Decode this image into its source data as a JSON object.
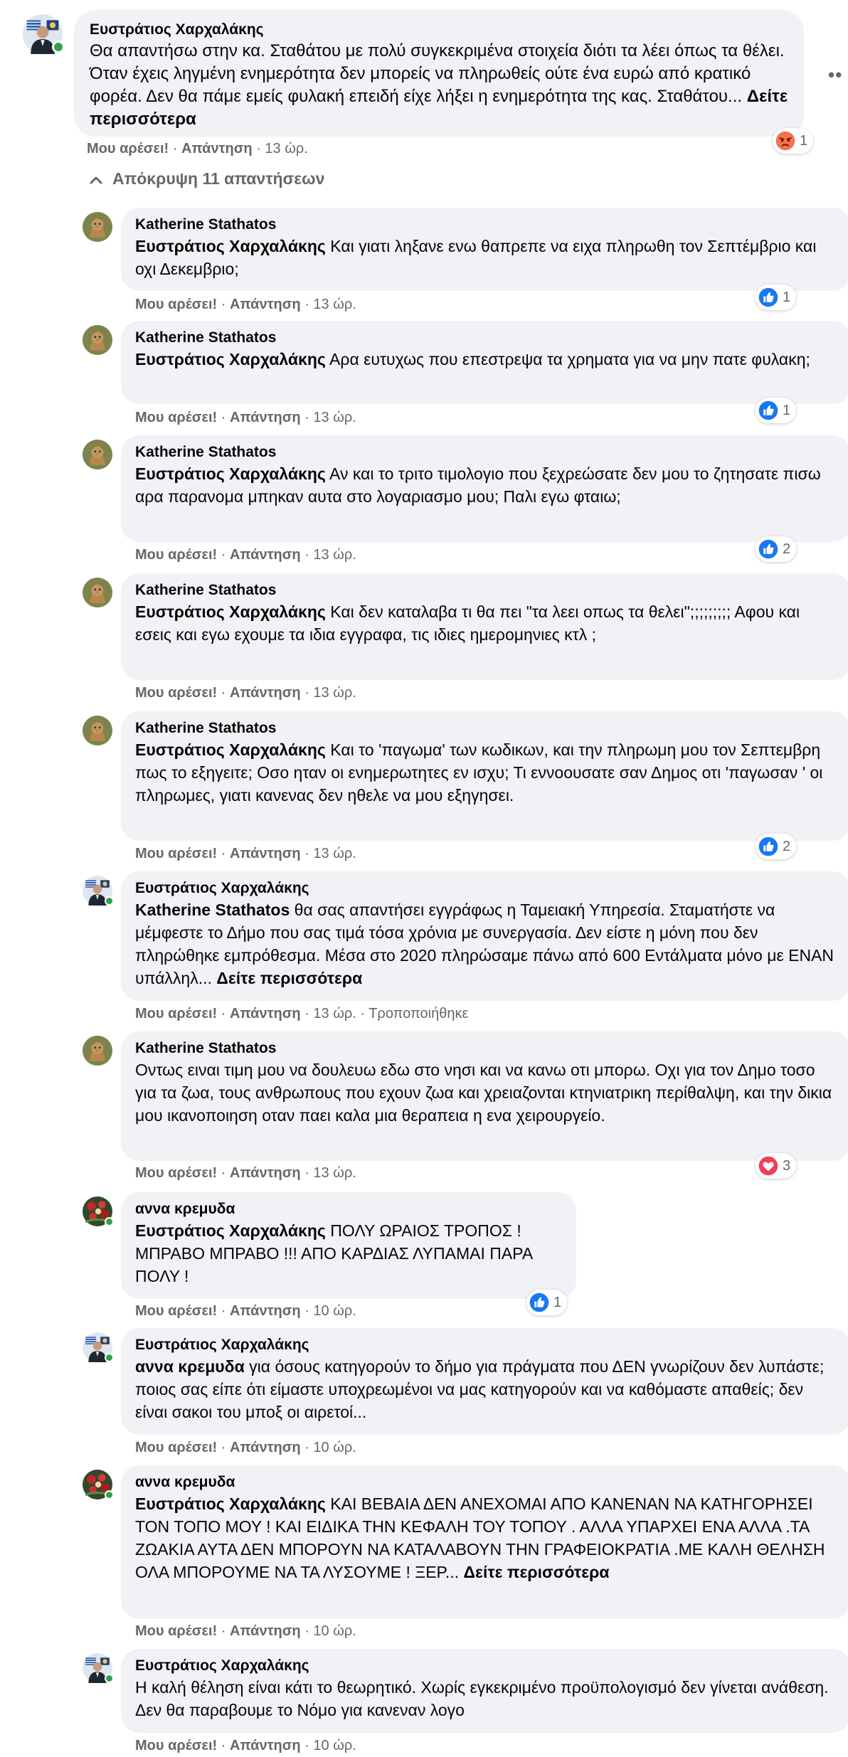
{
  "thread": {
    "actions": {
      "like": "Μου αρέσει!",
      "reply": "Απάντηση",
      "sep": "·",
      "edited": "Τροποποιήθηκε",
      "see_more": "Δείτε περισσότερα"
    },
    "toggle_label": "Απόκρυψη 11 απαντήσεων",
    "more_dots": "••"
  },
  "colors": {
    "bubble": "#f0f2f5",
    "meta_text": "#65676b",
    "like_blue": "#1877f2",
    "love_red": "#f33e58",
    "angry_orange": "#f7714c",
    "online_green": "#31a24c"
  },
  "comments": [
    {
      "author": "Ευστράτιος Χαρχαλάκης",
      "avatar_icon": "avatar-flag-photo",
      "online": true,
      "mention": "",
      "text": "Θα απαντήσω στην κα. Σταθάτου με πολύ συγκεκριμένα στοιχεία διότι τα λέει όπως τα θέλει. Όταν έχεις ληγμένη ενημερότητα δεν μπορείς να πληρωθείς ούτε ένα ευρώ από κρατικό φορέα. Δεν θα πάμε εμείς φυλακή επειδή είχε λήξει η ενημερότητα της κας. Σταθάτου...",
      "see_more": true,
      "time": "13 ώρ.",
      "edited": false,
      "reaction": {
        "icon": "angry-reaction-icon",
        "count": "1"
      }
    },
    {
      "author": "Katherine Stathatos",
      "avatar_icon": "avatar-cat-photo",
      "online": false,
      "mention": "Ευστράτιος Χαρχαλάκης",
      "text": "Και γιατι ληξανε ενω θαπρεπε να ειχα πληρωθη τον Σεπτέμβριο και οχι Δεκεμβριο;",
      "see_more": false,
      "time": "13 ώρ.",
      "edited": false,
      "reaction": {
        "icon": "like-reaction-icon",
        "count": "1"
      }
    },
    {
      "author": "Katherine Stathatos",
      "avatar_icon": "avatar-cat-photo",
      "online": false,
      "mention": "Ευστράτιος Χαρχαλάκης",
      "text": "Αρα ευτυχως που επεστρεψα τα χρηματα για να μην πατε φυλακη;",
      "see_more": false,
      "time": "13 ώρ.",
      "edited": false,
      "reaction": {
        "icon": "like-reaction-icon",
        "count": "1"
      }
    },
    {
      "author": "Katherine Stathatos",
      "avatar_icon": "avatar-cat-photo",
      "online": false,
      "mention": "Ευστράτιος Χαρχαλάκης",
      "text": "Αν και το τριτο τιμολογιο που ξεχρεώσατε δεν μου το ζητησατε πισω αρα παρανομα μπηκαν αυτα στο λογαριασμο μου; Παλι εγω φταιω;",
      "see_more": false,
      "time": "13 ώρ.",
      "edited": false,
      "reaction": {
        "icon": "like-reaction-icon",
        "count": "2"
      }
    },
    {
      "author": "Katherine Stathatos",
      "avatar_icon": "avatar-cat-photo",
      "online": false,
      "mention": "Ευστράτιος Χαρχαλάκης",
      "text": "Και δεν καταλαβα τι θα πει \"τα λεει οπως τα θελει\";;;;;;;;; Αφου και εσεις και εγω εχουμε τα ιδια εγγραφα, τις ιδιες ημερομηνιες κτλ ;",
      "see_more": false,
      "time": "13 ώρ.",
      "edited": false,
      "reaction": null
    },
    {
      "author": "Katherine Stathatos",
      "avatar_icon": "avatar-cat-photo",
      "online": false,
      "mention": "Ευστράτιος Χαρχαλάκης",
      "text": "Και το 'παγωμα' των κωδικων, και την πληρωμη μου τον Σεπτεμβρη πως το εξηγειτε; Οσο ηταν οι ενημερωτητες εν ισχυ; Τι εννοουσατε σαν Δημος οτι 'παγωσαν ' οι πληρωμες, γιατι κανενας δεν ηθελε να μου εξηγησει.",
      "see_more": false,
      "time": "13 ώρ.",
      "edited": false,
      "reaction": {
        "icon": "like-reaction-icon",
        "count": "2"
      }
    },
    {
      "author": "Ευστράτιος Χαρχαλάκης",
      "avatar_icon": "avatar-flag-photo",
      "online": true,
      "mention": "Katherine Stathatos",
      "text": "θα σας απαντήσει εγγράφως η Ταμειακή Υπηρεσία. Σταματήστε να μέμφεστε το Δήμο που σας τιμά τόσα χρόνια με συνεργασία. Δεν είστε η μόνη που δεν πληρώθηκε εμπρόθεσμα. Μέσα στο 2020 πληρώσαμε πάνω από 600 Εντάλματα μόνο με ΕΝΑΝ υπάλληλ...",
      "see_more": true,
      "time": "13 ώρ.",
      "edited": true,
      "reaction": null
    },
    {
      "author": "Katherine Stathatos",
      "avatar_icon": "avatar-cat-photo",
      "online": false,
      "mention": "",
      "text": "Οντως ειναι τιμη μου να δουλευω εδω στο νησι και να κανω οτι μπορω. Οχι για τον Δημο τοσο για τα ζωα, τους ανθρωπους που εχουν ζωα και χρειαζονται κτηνιατρικη περίθαλψη, και την δικια μου ικανοποιηση οταν παει καλα μια θεραπεια η ενα χειρουργείο.",
      "see_more": false,
      "time": "13 ώρ.",
      "edited": false,
      "reaction": {
        "icon": "love-reaction-icon",
        "count": "3"
      }
    },
    {
      "author": "αννα κρεμυδα",
      "avatar_icon": "avatar-flowers-photo",
      "online": true,
      "mention": "Ευστράτιος Χαρχαλάκης",
      "text": "ΠΟΛΥ ΩΡΑΙΟΣ ΤΡΟΠΟΣ ! ΜΠΡΑΒΟ ΜΠΡΑΒΟ !!! ΑΠΟ ΚΑΡΔΙΑΣ ΛΥΠΑΜΑΙ ΠΑΡΑ ΠΟΛΥ !",
      "see_more": false,
      "time": "10 ώρ.",
      "edited": false,
      "reaction": {
        "icon": "like-reaction-icon",
        "count": "1"
      }
    },
    {
      "author": "Ευστράτιος Χαρχαλάκης",
      "avatar_icon": "avatar-flag-photo",
      "online": true,
      "mention": "αννα κρεμυδα",
      "text": "για όσους κατηγορούν το δήμο για πράγματα που ΔΕΝ γνωρίζουν δεν λυπάστε; ποιος σας είπε ότι είμαστε υποχρεωμένοι να μας κατηγορούν και να καθόμαστε απαθείς; δεν είναι σακοι του μποξ οι αιρετοί...",
      "see_more": false,
      "time": "10 ώρ.",
      "edited": false,
      "reaction": null
    },
    {
      "author": "αννα κρεμυδα",
      "avatar_icon": "avatar-flowers-photo",
      "online": true,
      "mention": "Ευστράτιος Χαρχαλάκης",
      "text": "ΚΑΙ ΒΕΒΑΙΑ ΔΕΝ ΑΝΕΧΟΜΑΙ ΑΠΟ ΚΑΝΕΝΑΝ ΝΑ ΚΑΤΗΓΟΡΗΣΕΙ ΤΟΝ ΤΟΠΟ ΜΟΥ ! ΚΑΙ ΕΙΔΙΚΑ ΤΗΝ ΚΕΦΑΛΗ ΤΟΥ ΤΟΠΟΥ . ΑΛΛΑ ΥΠΑΡΧΕΙ ΕΝΑ ΑΛΛΑ .ΤΑ ΖΩΑΚΙΑ ΑΥΤΑ ΔΕΝ ΜΠΟΡΟΥΝ ΝΑ ΚΑΤΑΛΑΒΟΥΝ ΤΗΝ ΓΡΑΦΕΙΟΚΡΑΤΙΑ .ΜΕ ΚΑΛΗ ΘΕΛΗΣΗ ΟΛΑ ΜΠΟΡΟΥΜΕ ΝΑ ΤΑ ΛΥΣΟΥΜΕ ! ΞΕΡ...",
      "see_more": true,
      "time": "10 ώρ.",
      "edited": false,
      "reaction": null
    },
    {
      "author": "Ευστράτιος Χαρχαλάκης",
      "avatar_icon": "avatar-flag-photo",
      "online": true,
      "mention": "",
      "text": "Η καλή θέληση είναι κάτι το θεωρητικό. Χωρίς εγκεκριμένο προϋπολογισμό δεν γίνεται ανάθεση. Δεν θα παραβουμε το Νόμο για κανεναν λογο",
      "see_more": false,
      "time": "10 ώρ.",
      "edited": false,
      "reaction": null
    }
  ]
}
